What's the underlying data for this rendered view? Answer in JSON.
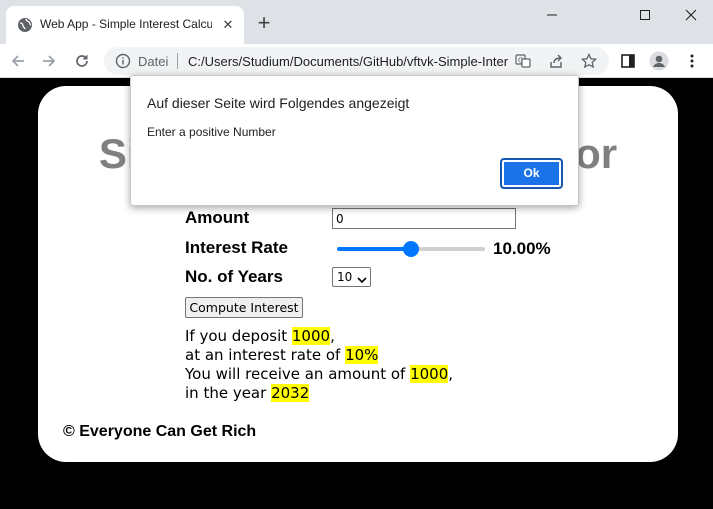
{
  "browser": {
    "tab_title": "Web App - Simple Interest Calculator",
    "address_scheme_label": "Datei",
    "url": "C:/Users/Studium/Documents/GitHub/vftvk-Simple-Interest-Calculator/index.html"
  },
  "page": {
    "title": "Simple Interest Calculator",
    "amount_label": "Amount",
    "amount_value": "0",
    "rate_label": "Interest Rate",
    "rate_fraction": 0.5,
    "rate_value": "10.00%",
    "years_label": "No. of Years",
    "years_value": "10",
    "compute_label": "Compute Interest",
    "result": {
      "line1_pre": "If you deposit ",
      "deposit": "1000",
      "line1_post": ",",
      "line2_pre": "at an interest rate of ",
      "rate": "10%",
      "line3_pre": "You will receive an amount of ",
      "amount": "1000",
      "line3_post": ",",
      "line4_pre": "in the year ",
      "year": "2032"
    },
    "footer": "© Everyone Can Get Rich"
  },
  "dialog": {
    "title": "Auf dieser Seite wird Folgendes angezeigt",
    "message": "Enter a positive Number",
    "ok_label": "Ok"
  },
  "colors": {
    "accent": "#1a73e8",
    "slider": "#0075ff",
    "highlight": "#ffff00",
    "title_gray": "#808080"
  }
}
